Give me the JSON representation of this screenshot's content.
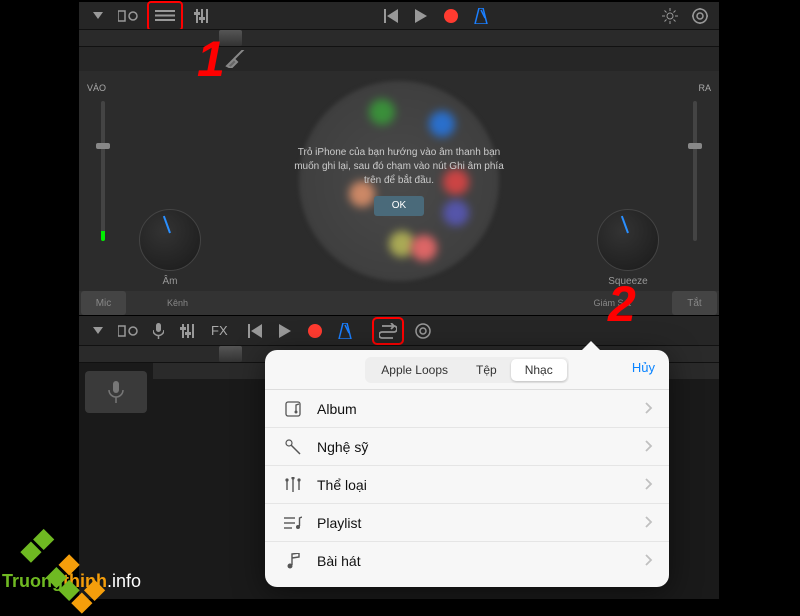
{
  "toolbar_top": {
    "side_left_label": "VÀO",
    "side_right_label": "RA"
  },
  "tip": {
    "text": "Trỏ iPhone của bạn hướng vào âm thanh bạn muốn ghi lại, sau đó chạm vào nút Ghi âm phía trên để bắt đầu.",
    "ok_label": "OK"
  },
  "knobs": {
    "left_label": "Âm",
    "right_label": "Squeeze"
  },
  "status": {
    "mic_label": "Mic",
    "off_label": "Tắt",
    "channel_label": "Kênh",
    "monitor_label": "Giám Sát"
  },
  "fx_label": "FX",
  "popup": {
    "tabs": {
      "apple_loops": "Apple Loops",
      "file": "Tệp",
      "music": "Nhạc"
    },
    "cancel": "Hủy",
    "rows": {
      "album": "Album",
      "artist": "Nghệ sỹ",
      "genre": "Thể loại",
      "playlist": "Playlist",
      "song": "Bài hát"
    }
  },
  "annotations": {
    "one": "1",
    "two": "2"
  },
  "watermark": {
    "text_1": "Truong",
    "text_2": "thinh",
    "text_3": ".info"
  }
}
